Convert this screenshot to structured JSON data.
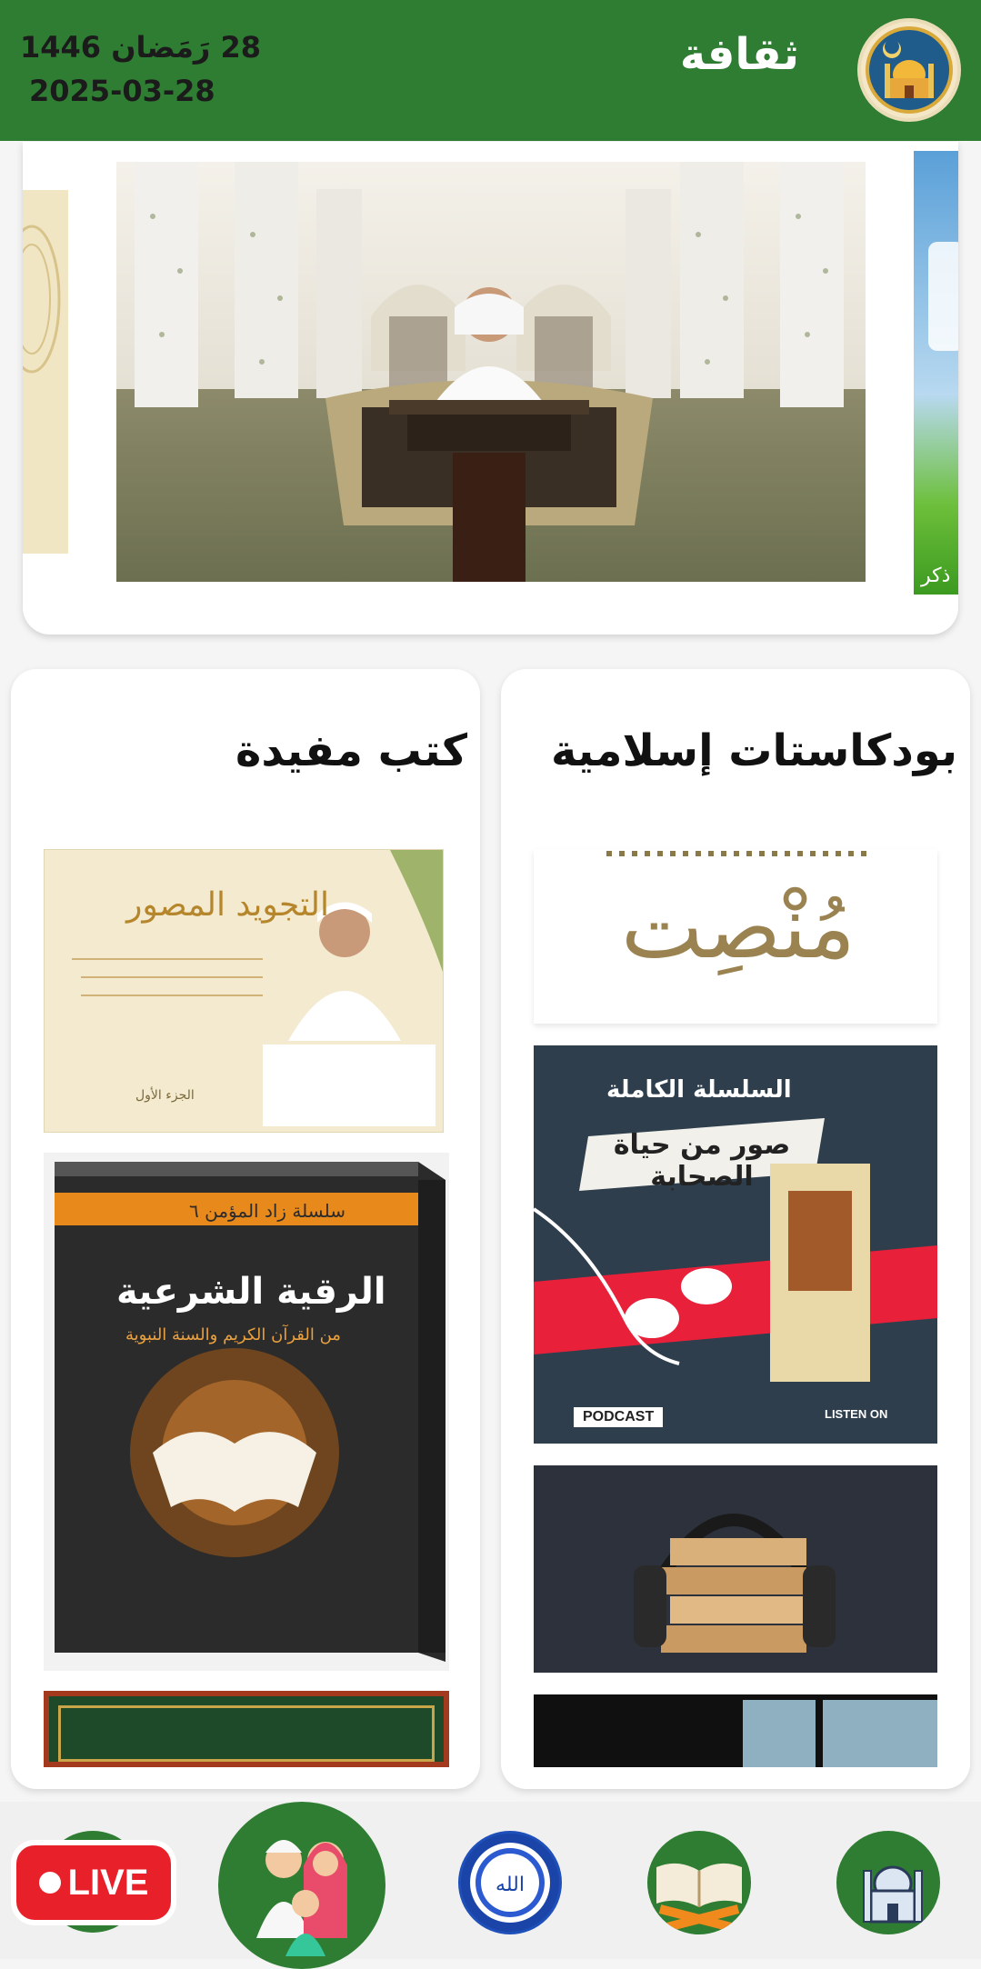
{
  "header": {
    "title": "ثقافة",
    "hijri_date": "28 رَمَضان 1446",
    "gregorian_date": "2025-03-28",
    "logo_icon": "mosque-logo-icon"
  },
  "carousel": {
    "slides": [
      "left-slide",
      "mosque-recitation-slide",
      "right-slide"
    ],
    "right_slide_text": "ذكر"
  },
  "books": {
    "title": "كتب مفيدة",
    "items": [
      {
        "title": "التجويد المصور",
        "subtitle": "الجزء الأول"
      },
      {
        "title": "الرقية الشرعية",
        "series": "سلسلة زاد المؤمن ٦",
        "subtitle": "من القرآن الكريم والسنة النبوية"
      },
      {
        "title": ""
      }
    ]
  },
  "podcasts": {
    "title": "بودكاستات إسلامية",
    "items": [
      {
        "title": "مُنْصِت"
      },
      {
        "title": "صور من حياة الصحابة",
        "series": "السلسلة الكاملة",
        "badge": "PODCAST",
        "listen": "LISTEN ON"
      },
      {
        "title": ""
      },
      {
        "title": ""
      }
    ]
  },
  "bottom_nav": {
    "live_label": "LIVE",
    "items": [
      "live-button",
      "family-icon",
      "allah-icon",
      "quran-icon",
      "mosque-icon"
    ]
  },
  "colors": {
    "header_bg": "#2e7d32",
    "live_red": "#e8202a",
    "accent_green": "#2e7d32"
  }
}
